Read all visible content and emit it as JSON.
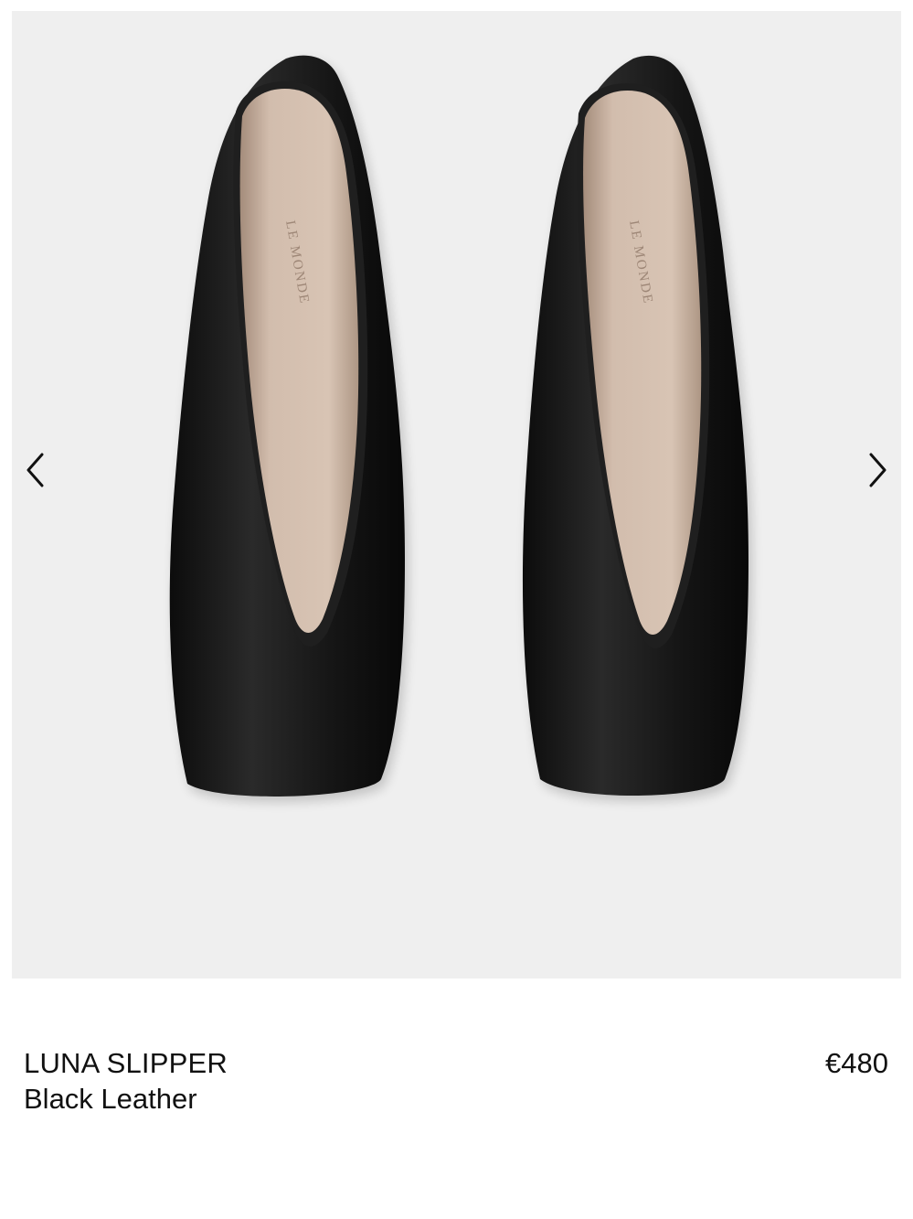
{
  "product": {
    "name": "LUNA SLIPPER",
    "variant": "Black Leather",
    "price": "€480",
    "image": {
      "description": "Pair of black leather slippers viewed from above",
      "insole_brand": "LE MONDE"
    }
  },
  "gallery": {
    "prev_icon": "chevron-left-icon",
    "next_icon": "chevron-right-icon"
  },
  "colors": {
    "image_background": "#efefef",
    "leather": "#141414",
    "insole": "#cdb7a6",
    "text": "#111111"
  }
}
